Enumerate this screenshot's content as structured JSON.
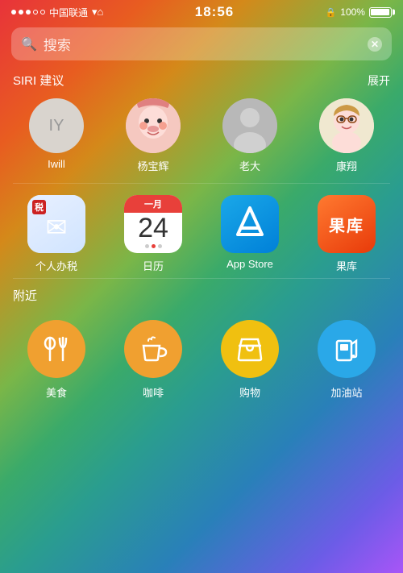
{
  "statusBar": {
    "signals": [
      "●",
      "●",
      "●",
      "○",
      "○"
    ],
    "carrier": "中国联通",
    "wifi": "▲",
    "time": "18:56",
    "lock": "🔒",
    "battery_pct": "100%"
  },
  "search": {
    "icon": "🔍",
    "placeholder": "搜索",
    "clear": "✕"
  },
  "siri": {
    "section_title": "SIRI 建议",
    "action": "展开",
    "contacts": [
      {
        "id": "iy",
        "label": "Iwill",
        "initials": "IY"
      },
      {
        "id": "yang",
        "label": "杨宝辉",
        "emoji": "😤"
      },
      {
        "id": "laoda",
        "label": "老大",
        "emoji": "👤"
      },
      {
        "id": "kang",
        "label": "康翔",
        "emoji": "🧓"
      }
    ]
  },
  "apps": {
    "items": [
      {
        "id": "tax",
        "label": "个人办税",
        "badge": "税"
      },
      {
        "id": "calendar",
        "label": "日历",
        "month": "一月",
        "day": "24"
      },
      {
        "id": "appstore",
        "label": "App Store",
        "symbol": ""
      },
      {
        "id": "guoku",
        "label": "果库",
        "text": "果库"
      }
    ]
  },
  "nearby": {
    "section_title": "附近",
    "items": [
      {
        "id": "food",
        "label": "美食",
        "emoji": "🍴"
      },
      {
        "id": "coffee",
        "label": "咖啡",
        "emoji": "☕"
      },
      {
        "id": "shop",
        "label": "购物",
        "emoji": "🛍"
      },
      {
        "id": "gas",
        "label": "加油站",
        "emoji": "⛽"
      }
    ]
  }
}
